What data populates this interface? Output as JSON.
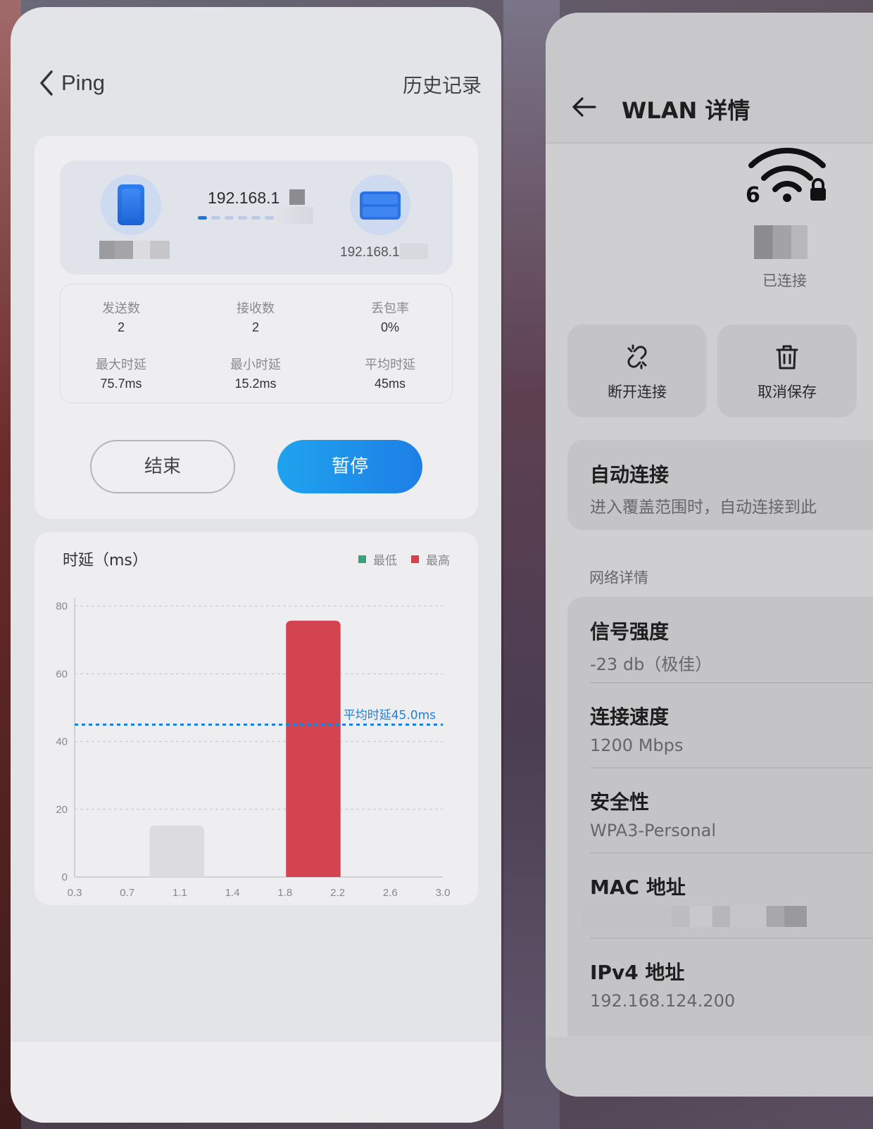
{
  "ping": {
    "title": "Ping",
    "history": "历史记录",
    "target_ip_prefix": "192.168.1",
    "local_ip_prefix": "192.168.1",
    "stats": {
      "sent_label": "发送数",
      "sent_value": "2",
      "recv_label": "接收数",
      "recv_value": "2",
      "loss_label": "丢包率",
      "loss_value": "0%",
      "max_label": "最大时延",
      "max_value": "75.7ms",
      "min_label": "最小时延",
      "min_value": "15.2ms",
      "avg_label": "平均时延",
      "avg_value": "45ms"
    },
    "buttons": {
      "end": "结束",
      "pause": "暂停"
    }
  },
  "chart_data": {
    "type": "bar",
    "title": "时延（ms）",
    "legend": [
      {
        "name": "最低",
        "color": "#3aa27a"
      },
      {
        "name": "最高",
        "color": "#d04450"
      }
    ],
    "x_ticks": [
      "0.3",
      "0.7",
      "1.1",
      "1.4",
      "1.8",
      "2.2",
      "2.6",
      "3.0"
    ],
    "y_ticks": [
      0,
      20,
      40,
      60,
      80
    ],
    "ylim": [
      0,
      80
    ],
    "xlim": [
      0.3,
      3.0
    ],
    "bars": [
      {
        "x_start": 0.85,
        "x_end": 1.25,
        "value": 15.2,
        "color": "#dcdcde"
      },
      {
        "x_start": 1.85,
        "x_end": 2.25,
        "value": 75.7,
        "color": "#d44450"
      }
    ],
    "average_line": {
      "value": 45.0,
      "label": "平均时延45.0ms",
      "color": "#1f7fd6"
    },
    "grid": true
  },
  "wlan": {
    "title": "WLAN 详情",
    "status": "已连接",
    "actions": {
      "disconnect": "断开连接",
      "forget": "取消保存"
    },
    "auto_connect": {
      "title": "自动连接",
      "subtitle": "进入覆盖范围时，自动连接到此"
    },
    "section_label": "网络详情",
    "details": [
      {
        "key": "信号强度",
        "value": "-23 db（极佳）"
      },
      {
        "key": "连接速度",
        "value": "1200 Mbps"
      },
      {
        "key": "安全性",
        "value": "WPA3-Personal"
      },
      {
        "key": "MAC 地址",
        "value": ""
      },
      {
        "key": "IPv4 地址",
        "value": "192.168.124.200"
      }
    ]
  }
}
